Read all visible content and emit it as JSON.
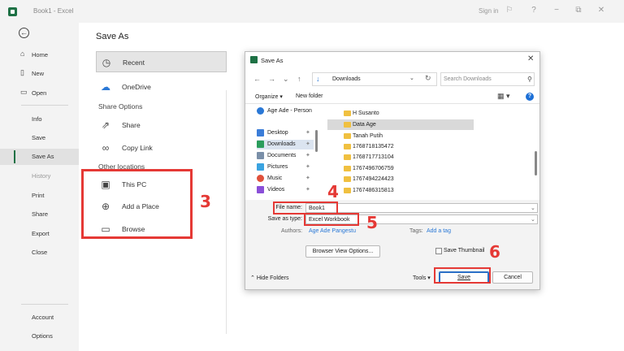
{
  "window": {
    "title": "Book1  -  Excel",
    "sign_in": "Sign in",
    "controls": {
      "feedback": "⚐",
      "help": "?",
      "minimize": "−",
      "restore": "⧉",
      "close": "✕"
    }
  },
  "nav": {
    "items": [
      {
        "label": "Home",
        "icon": "home-icon"
      },
      {
        "label": "New",
        "icon": "new-file-icon"
      },
      {
        "label": "Open",
        "icon": "folder-open-icon"
      },
      {
        "label": "Info"
      },
      {
        "label": "Save"
      },
      {
        "label": "Save As",
        "selected": true
      },
      {
        "label": "History",
        "disabled": true
      },
      {
        "label": "Print"
      },
      {
        "label": "Share"
      },
      {
        "label": "Export"
      },
      {
        "label": "Close"
      }
    ],
    "bottom": [
      {
        "label": "Account"
      },
      {
        "label": "Options"
      }
    ]
  },
  "saveas": {
    "title": "Save As",
    "recent": "Recent",
    "onedrive": "OneDrive",
    "share_options": "Share Options",
    "share": "Share",
    "copy_link": "Copy Link",
    "other_locations": "Other locations",
    "this_pc": "This PC",
    "add_place": "Add a Place",
    "browse": "Browse"
  },
  "annotations": {
    "n3": "3",
    "n4": "4",
    "n5": "5",
    "n6": "6"
  },
  "dialog": {
    "title": "Save As",
    "address": "Downloads",
    "search_placeholder": "Search Downloads",
    "organize": "Organize",
    "new_folder": "New folder",
    "tree": [
      {
        "label": "Age Ade - Person",
        "icon": "onedrive-icon",
        "color": "#2a78d6"
      },
      {
        "label": "Desktop",
        "icon": "desktop-icon",
        "color": "#3b7dd8"
      },
      {
        "label": "Downloads",
        "icon": "download-icon",
        "color": "#2a9d5c",
        "selected": true
      },
      {
        "label": "Documents",
        "icon": "documents-icon",
        "color": "#7a8fa8"
      },
      {
        "label": "Pictures",
        "icon": "pictures-icon",
        "color": "#3aa3e0"
      },
      {
        "label": "Music",
        "icon": "music-icon",
        "color": "#e0503a"
      },
      {
        "label": "Videos",
        "icon": "videos-icon",
        "color": "#8a4fd8"
      }
    ],
    "files": [
      {
        "name": "H Susanto"
      },
      {
        "name": "Data Age",
        "selected": true
      },
      {
        "name": "Tanah Putih"
      },
      {
        "name": "1768718135472"
      },
      {
        "name": "1768717713104"
      },
      {
        "name": "1767496706759"
      },
      {
        "name": "1767494224423"
      },
      {
        "name": "1767486315813"
      }
    ],
    "file_name_label": "File name:",
    "file_name_value": "Book1",
    "save_type_label": "Save as type:",
    "save_type_value": "Excel Workbook",
    "authors_label": "Authors:",
    "authors_value": "Age Ade Pangestu",
    "tags_label": "Tags:",
    "tags_value": "Add a tag",
    "browser_view": "Browser View Options...",
    "save_thumbnail": "Save Thumbnail",
    "hide_folders": "Hide Folders",
    "tools": "Tools",
    "save": "Save",
    "cancel": "Cancel"
  },
  "colors": {
    "accent": "#1e7145",
    "annotation": "#e53935",
    "link": "#2a78d6"
  }
}
